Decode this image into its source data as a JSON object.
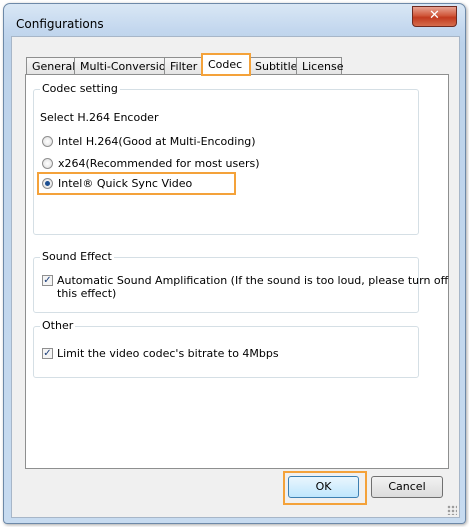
{
  "window": {
    "title": "Configurations",
    "close_glyph": "✕"
  },
  "tabs": [
    {
      "label": "General"
    },
    {
      "label": "Multi-Conversion"
    },
    {
      "label": "Filter"
    },
    {
      "label": "Codec",
      "active": true
    },
    {
      "label": "Subtitle"
    },
    {
      "label": "License"
    }
  ],
  "codec_group": {
    "label": "Codec setting",
    "prompt": "Select H.264 Encoder",
    "options": [
      {
        "label": "Intel H.264(Good at Multi-Encoding)",
        "selected": false
      },
      {
        "label": "x264(Recommended for most users)",
        "selected": false
      },
      {
        "label": "Intel® Quick Sync Video",
        "selected": true
      }
    ]
  },
  "sound_group": {
    "label": "Sound Effect",
    "option_line1": "Automatic Sound Amplification (If the sound is too loud, please turn off",
    "option_line2": "this effect)",
    "checked": true
  },
  "other_group": {
    "label": "Other",
    "option": "Limit the video codec's bitrate to 4Mbps",
    "checked": true
  },
  "buttons": {
    "ok": "OK",
    "cancel": "Cancel"
  },
  "colors": {
    "highlight": "#f4a23a",
    "title_bar": "#c3d7ee",
    "close_button": "#c23a1f"
  }
}
